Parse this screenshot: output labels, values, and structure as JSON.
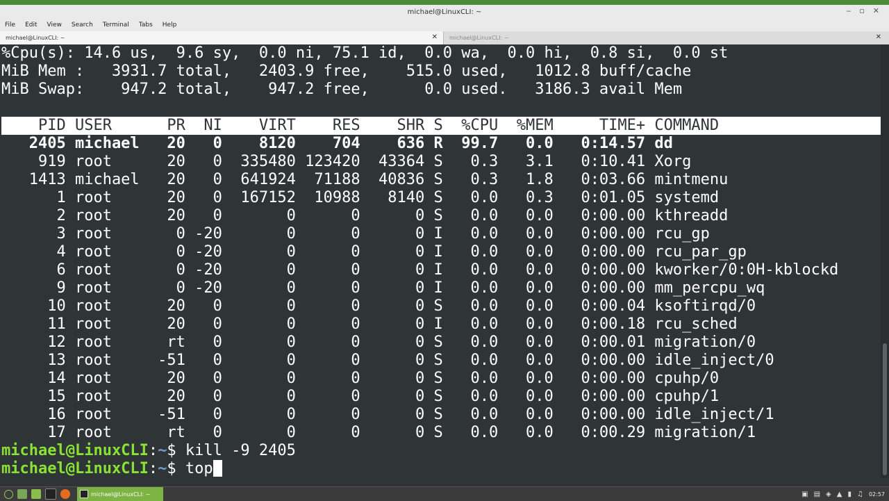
{
  "window": {
    "title": "michael@LinuxCLI: ~",
    "controls": [
      "‒",
      "▫",
      "✕"
    ]
  },
  "menu": [
    "File",
    "Edit",
    "View",
    "Search",
    "Terminal",
    "Tabs",
    "Help"
  ],
  "tabs": [
    {
      "label": "michael@LinuxCLI: ~",
      "close": "✕",
      "active": true
    },
    {
      "label": "michael@LinuxCLI: ~",
      "close": "✕",
      "active": false
    }
  ],
  "terminal": {
    "summary": [
      "%Cpu(s): 14.6 us,  9.6 sy,  0.0 ni, 75.1 id,  0.0 wa,  0.0 hi,  0.8 si,  0.0 st",
      "MiB Mem :   3931.7 total,   2403.9 free,    515.0 used,   1012.8 buff/cache",
      "MiB Swap:    947.2 total,    947.2 free,      0.0 used.   3186.3 avail Mem",
      ""
    ],
    "header": "    PID USER      PR  NI    VIRT    RES    SHR S  %CPU  %MEM     TIME+ COMMAND",
    "processes": [
      "   2405 michael   20   0    8120    704    636 R  99.7   0.0   0:14.57 dd",
      "    919 root      20   0  335480 123420  43364 S   0.3   3.1   0:10.41 Xorg",
      "   1413 michael   20   0  641924  71188  40836 S   0.3   1.8   0:03.66 mintmenu",
      "      1 root      20   0  167152  10988   8140 S   0.0   0.3   0:01.05 systemd",
      "      2 root      20   0       0      0      0 S   0.0   0.0   0:00.00 kthreadd",
      "      3 root       0 -20       0      0      0 I   0.0   0.0   0:00.00 rcu_gp",
      "      4 root       0 -20       0      0      0 I   0.0   0.0   0:00.00 rcu_par_gp",
      "      6 root       0 -20       0      0      0 I   0.0   0.0   0:00.00 kworker/0:0H-kblockd",
      "      9 root       0 -20       0      0      0 I   0.0   0.0   0:00.00 mm_percpu_wq",
      "     10 root      20   0       0      0      0 S   0.0   0.0   0:00.04 ksoftirqd/0",
      "     11 root      20   0       0      0      0 I   0.0   0.0   0:00.18 rcu_sched",
      "     12 root      rt   0       0      0      0 S   0.0   0.0   0:00.01 migration/0",
      "     13 root     -51   0       0      0      0 S   0.0   0.0   0:00.00 idle_inject/0",
      "     14 root      20   0       0      0      0 S   0.0   0.0   0:00.00 cpuhp/0",
      "     15 root      20   0       0      0      0 S   0.0   0.0   0:00.00 cpuhp/1",
      "     16 root     -51   0       0      0      0 S   0.0   0.0   0:00.00 idle_inject/1",
      "     17 root      rt   0       0      0      0 S   0.0   0.0   0:00.29 migration/1"
    ],
    "prompt": {
      "user_host": "michael@LinuxCLI",
      "colon": ":",
      "path": "~",
      "sigil": "$ "
    },
    "commands": [
      "kill -9 2405",
      "top"
    ]
  },
  "taskbar": {
    "task_label": "michael@LinuxCLI: ~",
    "clock": "02:57",
    "tray_icons": [
      "lock-icon",
      "clipboard-icon",
      "shield-icon",
      "network-icon",
      "battery-icon",
      "volume-icon"
    ]
  },
  "colors": {
    "terminal_bg": "#2f3437",
    "prompt_user": "#8ae234",
    "prompt_path": "#729fcf",
    "accent": "#7cb342"
  }
}
